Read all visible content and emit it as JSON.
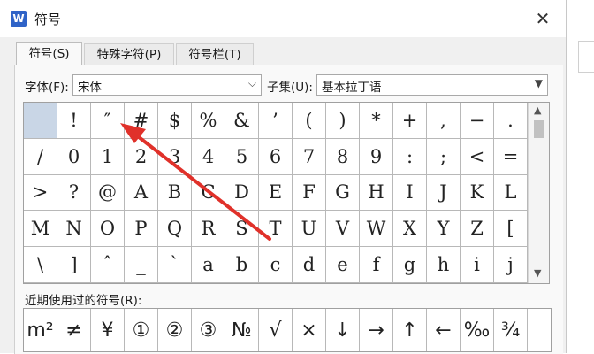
{
  "dialog": {
    "app_icon": "W",
    "title": "符号",
    "close": "✕"
  },
  "tabs": [
    {
      "label": "符号(S)",
      "active": true
    },
    {
      "label": "特殊字符(P)",
      "active": false
    },
    {
      "label": "符号栏(T)",
      "active": false
    }
  ],
  "font": {
    "label": "字体(F):",
    "value": "宋体"
  },
  "subset": {
    "label": "子集(U):",
    "value": "基本拉丁语"
  },
  "grid": {
    "cells": [
      "",
      "!",
      "″",
      "#",
      "$",
      "%",
      "&",
      "’",
      "(",
      ")",
      "*",
      "+",
      ",",
      "−",
      ".",
      "/",
      "0",
      "1",
      "2",
      "3",
      "4",
      "5",
      "6",
      "7",
      "8",
      "9",
      ":",
      ";",
      "<",
      "=",
      ">",
      "?",
      "@",
      "A",
      "B",
      "C",
      "D",
      "E",
      "F",
      "G",
      "H",
      "I",
      "J",
      "K",
      "L",
      "M",
      "N",
      "O",
      "P",
      "Q",
      "R",
      "S",
      "T",
      "U",
      "V",
      "W",
      "X",
      "Y",
      "Z",
      "[",
      "\\",
      "]",
      "ˆ",
      "_",
      "`",
      "a",
      "b",
      "c",
      "d",
      "e",
      "f",
      "g",
      "h",
      "i",
      "j"
    ],
    "selected_index": 0,
    "scroll_up": "▲",
    "scroll_down": "▼"
  },
  "recent": {
    "label": "近期使用过的符号(R):",
    "items": [
      "m²",
      "≠",
      "¥",
      "①",
      "②",
      "③",
      "№",
      "√",
      "×",
      "↓",
      "→",
      "↑",
      "←",
      "‰",
      "¾"
    ]
  },
  "colors": {
    "annotation_arrow": "#e0312a",
    "selected_cell": "#c9d6e6",
    "app_icon": "#2f63c7"
  },
  "icons": {
    "dropdown": "chevron-down-icon",
    "close": "close-icon",
    "app": "wps-writer-icon"
  }
}
